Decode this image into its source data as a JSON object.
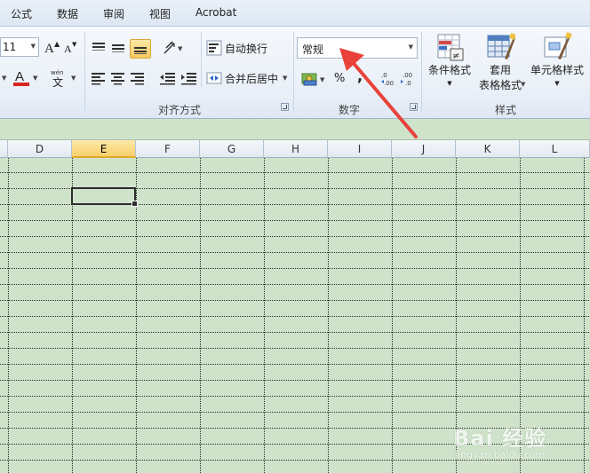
{
  "menu": {
    "tabs": [
      {
        "label": "公式"
      },
      {
        "label": "数据"
      },
      {
        "label": "审阅"
      },
      {
        "label": "视图"
      },
      {
        "label": "Acrobat"
      }
    ]
  },
  "ribbon": {
    "font": {
      "size_value": "11",
      "pinyin_glyph": "wén",
      "font_color": "#d7261e"
    },
    "alignment": {
      "group_label": "对齐方式",
      "wrap_text_label": "自动换行",
      "merge_center_label": "合并后居中"
    },
    "number": {
      "group_label": "数字",
      "format_value": "常规",
      "percent_symbol": "%",
      "comma_symbol": ","
    },
    "styles": {
      "group_label": "样式",
      "conditional_format_label": "条件格式",
      "table_format_label_line1": "套用",
      "table_format_label_line2": "表格格式",
      "cell_styles_label": "单元格样式"
    }
  },
  "sheet": {
    "columns": [
      "D",
      "E",
      "F",
      "G",
      "H",
      "I",
      "J",
      "K",
      "L"
    ],
    "selected_column": "E",
    "grid_color": "#cfe3cb",
    "selection_border_color": "#2d2d2d"
  },
  "annotation": {
    "arrow_color": "#e8423a"
  },
  "watermark": {
    "main": "Bai 经验",
    "sub": "jingyan.baidu.com"
  }
}
